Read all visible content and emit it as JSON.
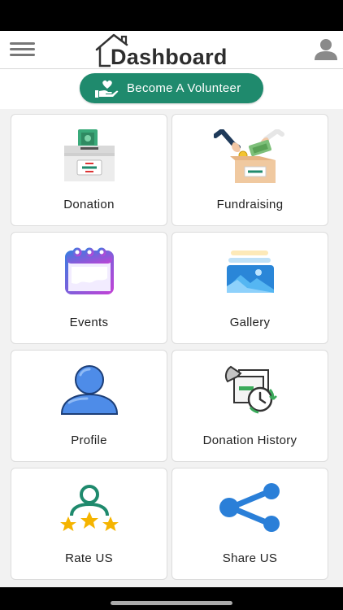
{
  "header": {
    "title": "Dashboard",
    "menu_icon": "hamburger-menu-icon",
    "user_icon": "user-account-icon",
    "logo_icon": "house-outline-icon"
  },
  "volunteer": {
    "label": "Become A Volunteer",
    "icon": "hand-heart-icon",
    "color": "#1f8a6d"
  },
  "tiles": [
    {
      "label": "Donation",
      "icon": "donation-box-icon"
    },
    {
      "label": "Fundraising",
      "icon": "fundraising-hands-icon"
    },
    {
      "label": "Events",
      "icon": "calendar-icon"
    },
    {
      "label": "Gallery",
      "icon": "gallery-image-icon"
    },
    {
      "label": "Profile",
      "icon": "profile-person-icon"
    },
    {
      "label": "Donation History",
      "icon": "donation-history-clock-icon"
    },
    {
      "label": "Rate US",
      "icon": "rate-stars-icon"
    },
    {
      "label": "Share US",
      "icon": "share-icon"
    }
  ]
}
